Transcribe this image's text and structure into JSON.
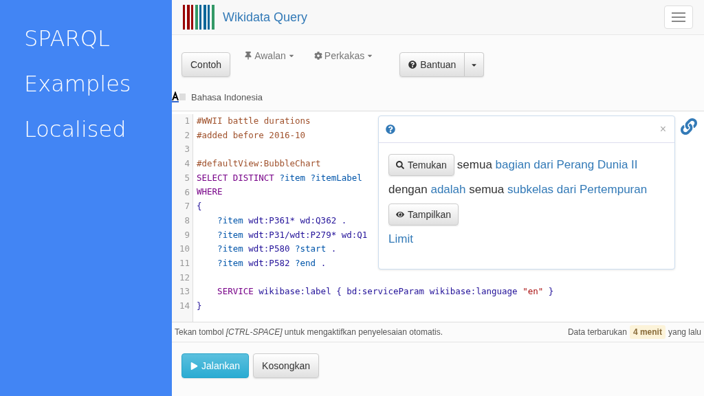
{
  "slide": {
    "lines": [
      "SPARQL",
      "Examples",
      "Localised"
    ]
  },
  "app": {
    "title": "Wikidata Query",
    "toolbar": [
      {
        "label": "Contoh",
        "kind": "button"
      },
      {
        "label": "Awalan",
        "kind": "menu"
      },
      {
        "label": "Perkakas",
        "kind": "menu"
      },
      {
        "label": "Bantuan",
        "kind": "split"
      }
    ],
    "language": "Bahasa Indonesia",
    "code": [
      {
        "number": "1",
        "tokens": [
          {
            "t": "#WWII battle durations",
            "kind": "comment"
          }
        ]
      },
      {
        "number": "2",
        "tokens": [
          {
            "t": "#added before 2016-10",
            "kind": "comment"
          }
        ]
      },
      {
        "number": "3"
      },
      {
        "number": "4",
        "tokens": [
          {
            "t": "#defaultView:BubbleChart",
            "kind": "comment"
          }
        ]
      },
      {
        "number": "5",
        "tokens": [
          {
            "t": "SELECT DISTINCT ",
            "kind": "keyword"
          },
          {
            "t": "?item ?itemLabel",
            "kind": "variable"
          }
        ]
      },
      {
        "number": "6",
        "tokens": [
          {
            "t": "WHERE",
            "kind": "keyword"
          }
        ]
      },
      {
        "number": "7",
        "tokens": [
          {
            "t": "{",
            "kind": "plain"
          }
        ]
      },
      {
        "number": "8",
        "tokens": [
          {
            "t": "    ?item ",
            "kind": "variable"
          },
          {
            "t": "wdt:P361* wd:Q362 .",
            "kind": "plain"
          }
        ]
      },
      {
        "number": "9",
        "tokens": [
          {
            "t": "    ?item ",
            "kind": "variable"
          },
          {
            "t": "wdt:P31/wdt:P279* wd:Q1",
            "kind": "plain"
          }
        ]
      },
      {
        "number": "10",
        "tokens": [
          {
            "t": "    ?item ",
            "kind": "variable"
          },
          {
            "t": "wdt:P580 ",
            "kind": "plain"
          },
          {
            "t": "?start",
            "kind": "variable"
          },
          {
            "t": " .",
            "kind": "plain"
          }
        ]
      },
      {
        "number": "11",
        "tokens": [
          {
            "t": "    ?item ",
            "kind": "variable"
          },
          {
            "t": "wdt:P582 ",
            "kind": "plain"
          },
          {
            "t": "?end",
            "kind": "variable"
          },
          {
            "t": " .",
            "kind": "plain"
          }
        ]
      },
      {
        "number": "12"
      },
      {
        "number": "13",
        "tokens": [
          {
            "t": "    SERVICE ",
            "kind": "keyword"
          },
          {
            "t": "wikibase:label { bd:serviceParam wikibase:language ",
            "kind": "plain"
          },
          {
            "t": "\"en\"",
            "kind": "string"
          },
          {
            "t": " }",
            "kind": "plain"
          }
        ]
      },
      {
        "number": "14",
        "tokens": [
          {
            "t": "}",
            "kind": "plain"
          }
        ]
      }
    ],
    "helper": {
      "close": "×",
      "find_button": "Temukan",
      "lines": [
        [
          {
            "t": "semua ",
            "kind": "text"
          },
          {
            "t": "bagian dari Perang Dunia II",
            "kind": "link"
          }
        ],
        [
          {
            "t": "dengan ",
            "kind": "text"
          },
          {
            "t": "adalah",
            "kind": "link"
          },
          {
            "t": " semua ",
            "kind": "text"
          },
          {
            "t": "subkelas dari Pertempuran",
            "kind": "link"
          }
        ]
      ],
      "show_button": "Tampilkan",
      "limit": "Limit"
    },
    "status": {
      "hint": "Tekan tombol *[CTRL-SPACE]* untuk mengaktifkan penyelesaian otomatis.",
      "updated_before": "Data terbarukan",
      "updated_badge": "4 menit",
      "updated_after": "yang lalu"
    },
    "actions": [
      {
        "label": "Jalankan",
        "kind": "primary"
      },
      {
        "label": "Kosongkan",
        "kind": "default"
      }
    ]
  }
}
